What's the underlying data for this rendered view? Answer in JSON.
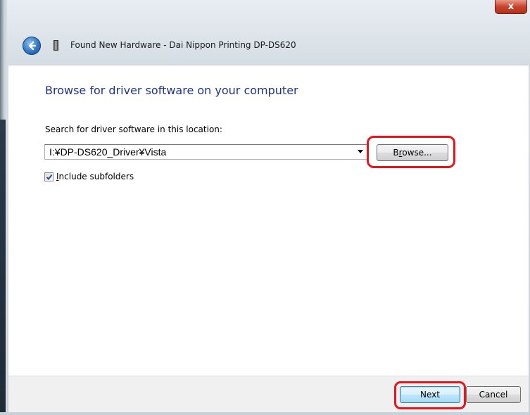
{
  "window": {
    "title": "Found New Hardware - Dai Nippon Printing DP-DS620",
    "close_label": "x"
  },
  "icons": {
    "back": "back-arrow-icon",
    "hardware": "hardware-device-icon",
    "dropdown": "chevron-down-icon",
    "check": "checkmark-icon"
  },
  "main": {
    "heading": "Browse for driver software on your computer",
    "search_label": "Search for driver software in this location:",
    "path_value": "I:¥DP-DS620_Driver¥Vista",
    "browse": {
      "mnemonic": "r",
      "prefix": "B",
      "suffix": "owse..."
    },
    "include_subfolders": {
      "checked": true,
      "mnemonic": "I",
      "rest": "nclude subfolders"
    }
  },
  "footer": {
    "next_label": "Next",
    "cancel_label": "Cancel"
  },
  "colors": {
    "heading": "#1e3287",
    "highlight": "#e8141c",
    "close_button": "#c8432e"
  }
}
